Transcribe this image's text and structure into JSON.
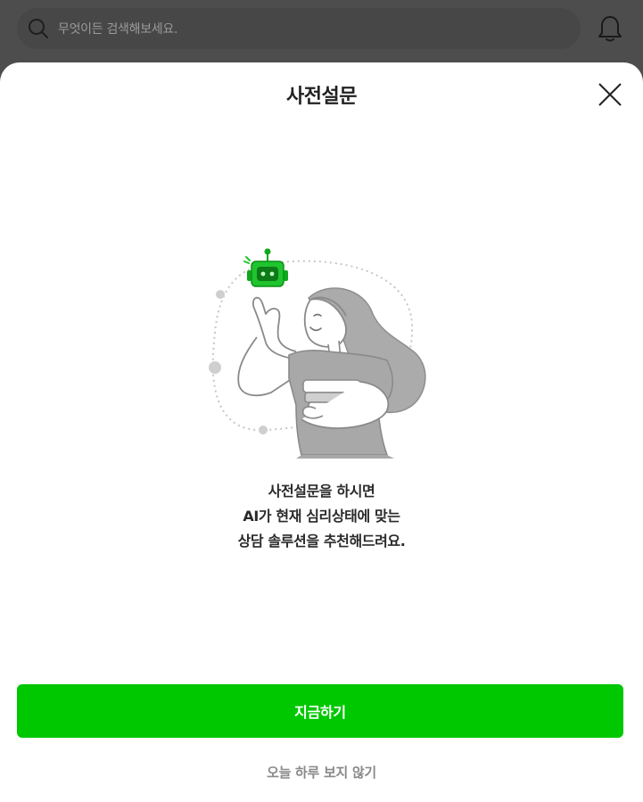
{
  "header": {
    "search_placeholder": "무엇이든 검색해보세요.",
    "search_icon": "search-icon",
    "notification_icon": "bell-icon"
  },
  "modal": {
    "title": "사전설문",
    "close_icon": "close-icon",
    "illustration": "robot-and-woman-with-books",
    "description_lines": [
      "사전설문을 하시면",
      "AI가 현재 심리상태에 맞는",
      "상담 솔루션을 추천해드려요."
    ],
    "primary_button_label": "지금하기",
    "dismiss_label": "오늘 하루 보지 않기"
  },
  "colors": {
    "accent": "#00c800",
    "overlay": "#4d4d4d",
    "sheet_background": "#ffffff",
    "dismiss_text": "#8a8a8a"
  }
}
